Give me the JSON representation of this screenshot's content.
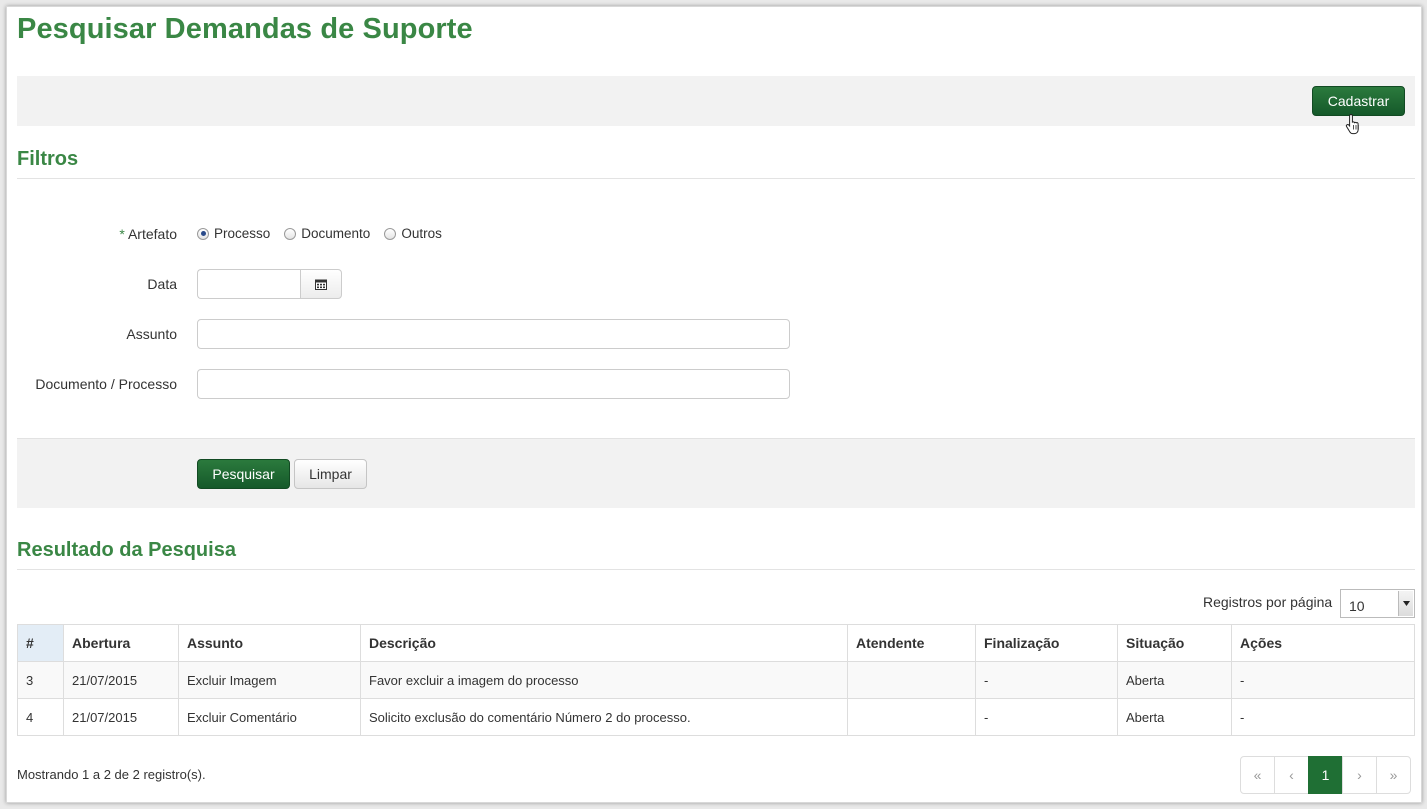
{
  "page": {
    "title": "Pesquisar Demandas de Suporte"
  },
  "toolbar": {
    "cadastrar_label": "Cadastrar"
  },
  "filters": {
    "section_title": "Filtros",
    "artefato": {
      "required_mark": "*",
      "label": "Artefato",
      "options": [
        "Processo",
        "Documento",
        "Outros"
      ],
      "selected": "Processo"
    },
    "data": {
      "label": "Data",
      "value": ""
    },
    "assunto": {
      "label": "Assunto",
      "value": ""
    },
    "documento_processo": {
      "label": "Documento / Processo",
      "value": ""
    },
    "pesquisar_label": "Pesquisar",
    "limpar_label": "Limpar"
  },
  "results": {
    "section_title": "Resultado da Pesquisa",
    "per_page_label": "Registros por página",
    "per_page_value": "10",
    "columns": [
      "#",
      "Abertura",
      "Assunto",
      "Descrição",
      "Atendente",
      "Finalização",
      "Situação",
      "Ações"
    ],
    "rows": [
      [
        "3",
        "21/07/2015",
        "Excluir Imagem",
        "Favor excluir a imagem do processo",
        "",
        "-",
        "Aberta",
        "-"
      ],
      [
        "4",
        "21/07/2015",
        "Excluir Comentário",
        "Solicito exclusão do comentário Número 2 do processo.",
        "",
        "-",
        "Aberta",
        "-"
      ]
    ],
    "summary": "Mostrando 1 a 2 de 2 registro(s).",
    "pagination": {
      "first": "«",
      "prev": "‹",
      "current": "1",
      "next": "›",
      "last": "»"
    }
  },
  "colors": {
    "brand_green": "#3a8745",
    "button_green": "#1f6f34"
  },
  "icons": {
    "calendar": "calendar-icon",
    "cursor": "hand-cursor-icon",
    "select_arrow": "caret-down-icon"
  }
}
